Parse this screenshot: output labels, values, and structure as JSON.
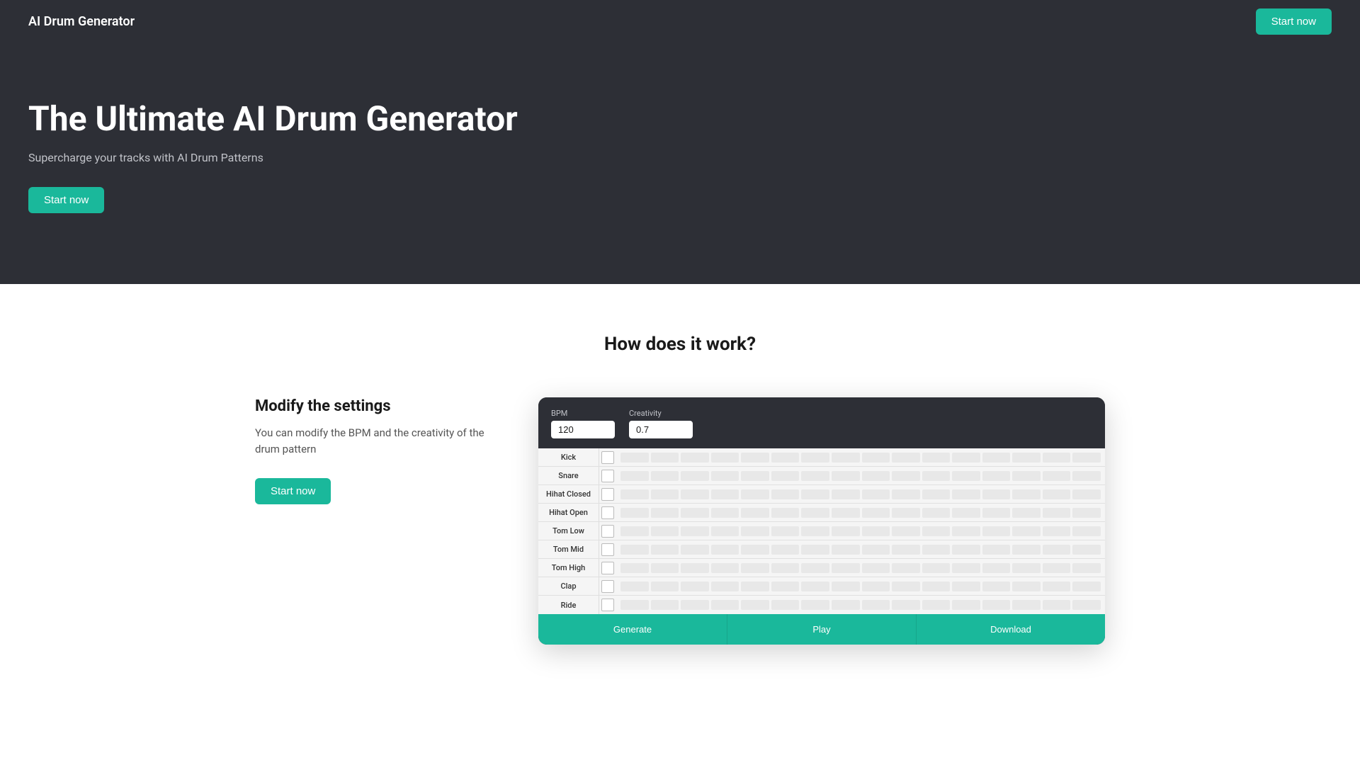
{
  "nav": {
    "logo": "AI Drum Generator",
    "start_now_label": "Start now"
  },
  "hero": {
    "title": "The Ultimate AI Drum Generator",
    "subtitle": "Supercharge your tracks with AI Drum Patterns",
    "cta_label": "Start now"
  },
  "how": {
    "section_title": "How does it work?",
    "block_title": "Modify the settings",
    "block_desc": "You can modify the BPM and the creativity of the drum pattern",
    "cta_label": "Start now"
  },
  "drum_machine": {
    "bpm_label": "BPM",
    "bpm_value": "120",
    "creativity_label": "Creativity",
    "creativity_value": "0.7",
    "rows": [
      "Kick",
      "Snare",
      "Hihat Closed",
      "Hihat Open",
      "Tom Low",
      "Tom Mid",
      "Tom High",
      "Clap",
      "Ride"
    ],
    "generate_label": "Generate",
    "play_label": "Play",
    "download_label": "Download"
  }
}
